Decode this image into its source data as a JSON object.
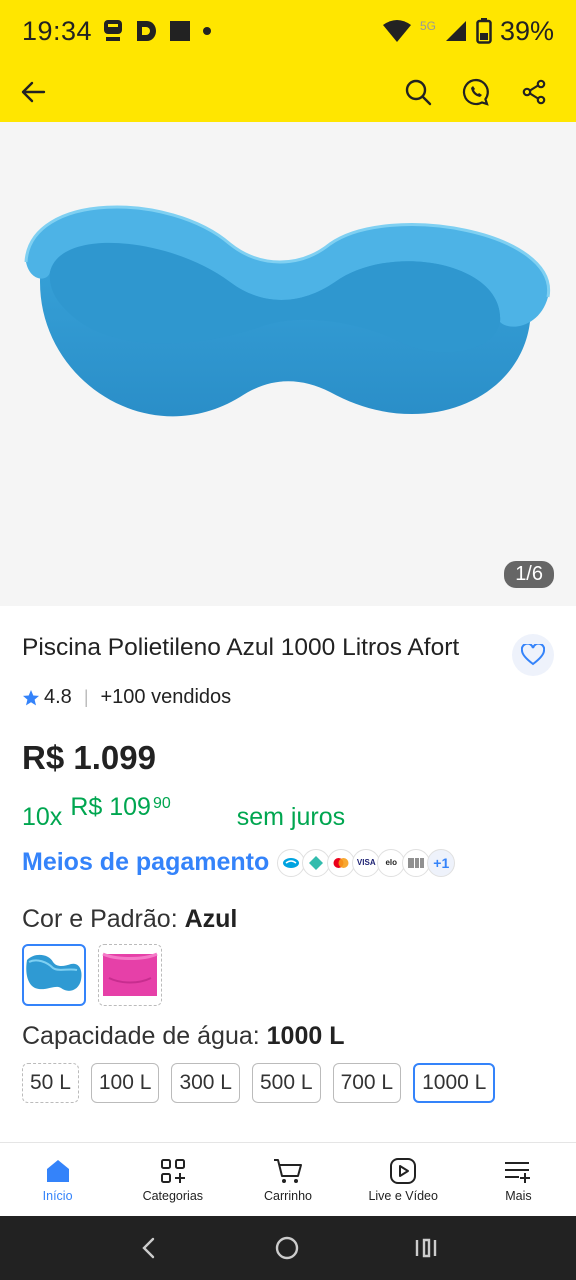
{
  "status": {
    "time": "19:34",
    "network": "5G",
    "battery": "39%"
  },
  "product": {
    "image_counter": "1/6",
    "title": "Piscina Polietileno Azul 1000 Litros Afort",
    "rating": "4.8",
    "sold": "+100 vendidos",
    "price": "R$ 1.099",
    "installments_count": "10x",
    "installment_value": "R$ 109",
    "installment_cents": "90",
    "installment_note": "sem juros",
    "payment_link": "Meios de pagamento",
    "payment_more": "+1"
  },
  "variants": {
    "color_label": "Cor e Padrão:",
    "color_value": "Azul",
    "capacity_label": "Capacidade de água:",
    "capacity_value": "1000 L",
    "capacities": [
      "50 L",
      "100 L",
      "300 L",
      "500 L",
      "700 L",
      "1000 L"
    ]
  },
  "nav": {
    "items": [
      "Início",
      "Categorias",
      "Carrinho",
      "Live e Vídeo",
      "Mais"
    ]
  },
  "colors": {
    "brand_yellow": "#ffe600",
    "link_blue": "#3483fa",
    "green": "#00a650"
  }
}
